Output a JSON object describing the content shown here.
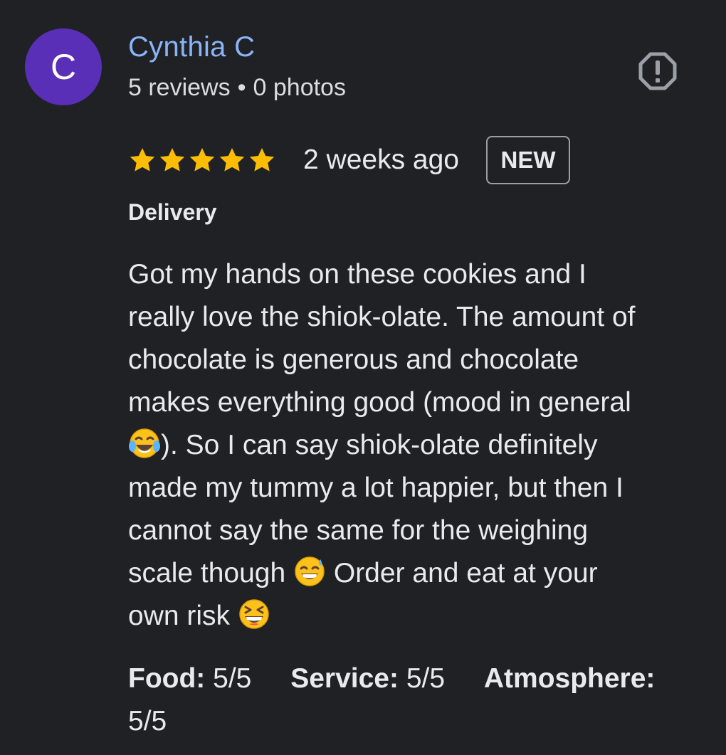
{
  "reviewer": {
    "initial": "C",
    "avatar_color": "#5a2fb7",
    "name": "Cynthia C",
    "reviews": "5 reviews",
    "separator": "•",
    "photos": "0 photos"
  },
  "report_icon": "report-flag-icon",
  "rating": {
    "stars": 5,
    "max_stars": 5,
    "star_color": "#fbbc04",
    "time_ago": "2 weeks ago",
    "badge": "NEW"
  },
  "service_type": "Delivery",
  "review_lines": [
    "Got my hands on these cookies and I",
    "really love the shiok-olate. The amount of",
    "chocolate is generous and chocolate",
    "makes everything good (mood in general",
    "). So I can say shiok-olate definitely",
    "made my tummy a lot happier, but then I",
    "cannot say the same for the weighing",
    "scale though",
    "Order and eat at your",
    "own risk"
  ],
  "emojis": [
    "face-with-tears-of-joy",
    "grinning-face-with-sweat",
    "grinning-squinting-face"
  ],
  "subratings": {
    "food_label": "Food:",
    "food_value": "5/5",
    "service_label": "Service:",
    "service_value": "5/5",
    "atmosphere_label": "Atmosphere:",
    "atmosphere_value": "5/5"
  }
}
